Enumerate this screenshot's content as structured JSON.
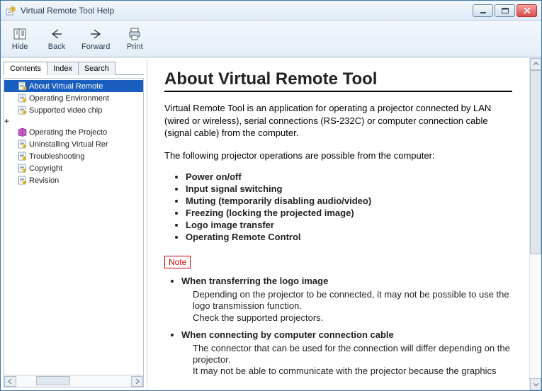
{
  "window": {
    "title": "Virtual Remote Tool Help"
  },
  "toolbar": {
    "hide": "Hide",
    "back": "Back",
    "forward": "Forward",
    "print": "Print"
  },
  "tabs": {
    "contents": "Contents",
    "index": "Index",
    "search": "Search"
  },
  "tree": {
    "items": [
      {
        "label": "About Virtual Remote",
        "selected": true
      },
      {
        "label": "Operating Environment"
      },
      {
        "label": "Supported video chip"
      },
      {
        "label": "Operating the Projecto",
        "expandable": true,
        "book": true
      },
      {
        "label": "Uninstalling Virtual Rer"
      },
      {
        "label": "Troubleshooting"
      },
      {
        "label": "Copyright"
      },
      {
        "label": "Revision"
      }
    ]
  },
  "content": {
    "h1": "About Virtual Remote Tool",
    "intro": "Virtual Remote Tool is an application for operating a projector connected by LAN (wired or wireless), serial connections (RS-232C) or computer connection cable (signal cable) from the computer.",
    "ops_lead": "The following projector operations are possible from the computer:",
    "ops": [
      "Power on/off",
      "Input signal switching",
      "Muting (temporarily disabling audio/video)",
      "Freezing (locking the projected image)",
      "Logo image transfer",
      "Operating Remote Control"
    ],
    "note_label": "Note",
    "notes": [
      {
        "title": "When transferring the logo image",
        "body": "Depending on the projector to be connected, it may not be possible to use the logo transmission function.\nCheck the supported projectors."
      },
      {
        "title": "When connecting by computer connection cable",
        "body": "The connector that can be used for the connection will differ depending on the projector.\nIt may not be able to communicate with the projector because the graphics"
      }
    ]
  }
}
